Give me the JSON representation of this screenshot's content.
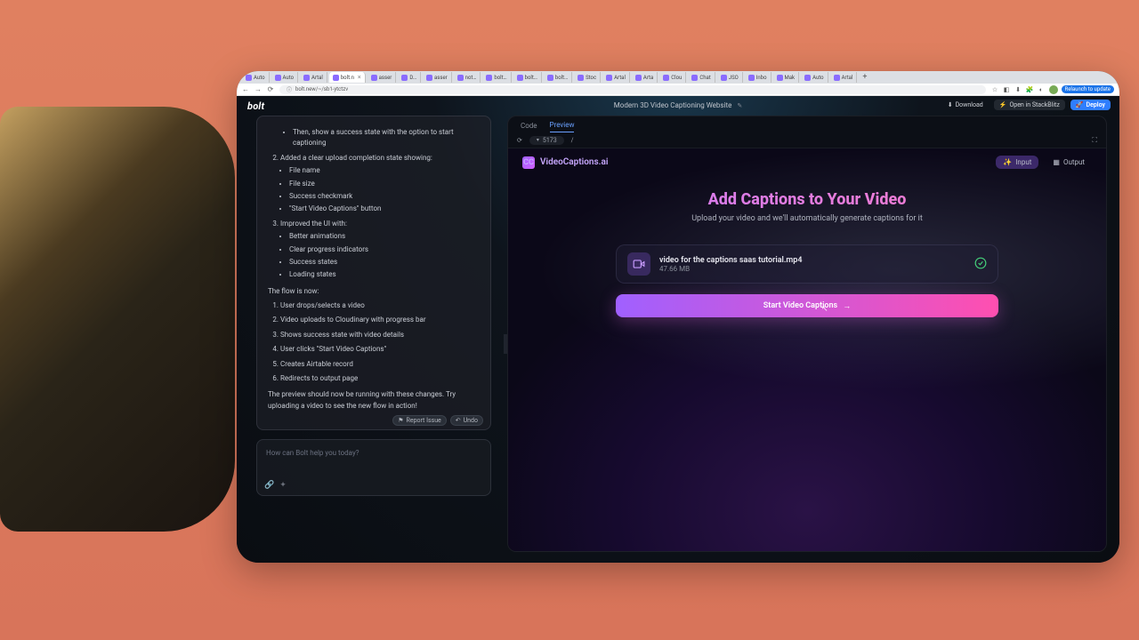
{
  "browser": {
    "url": "bolt.new/~/sb1-ytctzv",
    "lock": "⌂",
    "relaunch_label": "Relaunch to update",
    "tabs": [
      {
        "label": "Auto"
      },
      {
        "label": "Auto"
      },
      {
        "label": "Artal"
      },
      {
        "label": "bolt.n",
        "active": true
      },
      {
        "label": "asser"
      },
      {
        "label": "D…"
      },
      {
        "label": "asser"
      },
      {
        "label": "not…"
      },
      {
        "label": "bolt…"
      },
      {
        "label": "bolt…"
      },
      {
        "label": "bolt…"
      },
      {
        "label": "Stoc"
      },
      {
        "label": "Artal"
      },
      {
        "label": "Arta"
      },
      {
        "label": "Clou"
      },
      {
        "label": "Chat"
      },
      {
        "label": "JSO"
      },
      {
        "label": "Inbo"
      },
      {
        "label": "Mak"
      },
      {
        "label": "Auto"
      },
      {
        "label": "Artal"
      }
    ]
  },
  "bolt": {
    "logo": "bolt",
    "project_title": "Modern 3D Video Captioning Website",
    "top_buttons": {
      "download": "Download",
      "open_stackblitz": "Open in StackBlitz",
      "deploy": "Deploy"
    },
    "ai": {
      "item1_text": "Then, show a success state with the option to start captioning",
      "item2_label": "Added a clear upload completion state showing:",
      "item2_subs": [
        "File name",
        "File size",
        "Success checkmark",
        "\"Start Video Captions\" button"
      ],
      "item3_label": "Improved the UI with:",
      "item3_subs": [
        "Better animations",
        "Clear progress indicators",
        "Success states",
        "Loading states"
      ],
      "flow_intro": "The flow is now:",
      "flow": [
        "User drops/selects a video",
        "Video uploads to Cloudinary with progress bar",
        "Shows success state with video details",
        "User clicks \"Start Video Captions\"",
        "Creates Airtable record",
        "Redirects to output page"
      ],
      "outro": "The preview should now be running with these changes. Try uploading a video to see the new flow in action!",
      "report_label": "Report Issue",
      "undo_label": "Undo"
    },
    "chat_input_placeholder": "How can Bolt help you today?"
  },
  "preview": {
    "tabs": {
      "code": "Code",
      "preview": "Preview"
    },
    "port": "5173",
    "path": "/",
    "app": {
      "brand": "VideoCaptions.ai",
      "io_tabs": {
        "input": "Input",
        "output": "Output"
      },
      "hero_title": "Add Captions to Your Video",
      "hero_sub": "Upload your video and we'll automatically generate captions for it",
      "file_name": "video for the captions saas tutorial.mp4",
      "file_size": "47.66 MB",
      "start_label": "Start Video Captions"
    }
  }
}
